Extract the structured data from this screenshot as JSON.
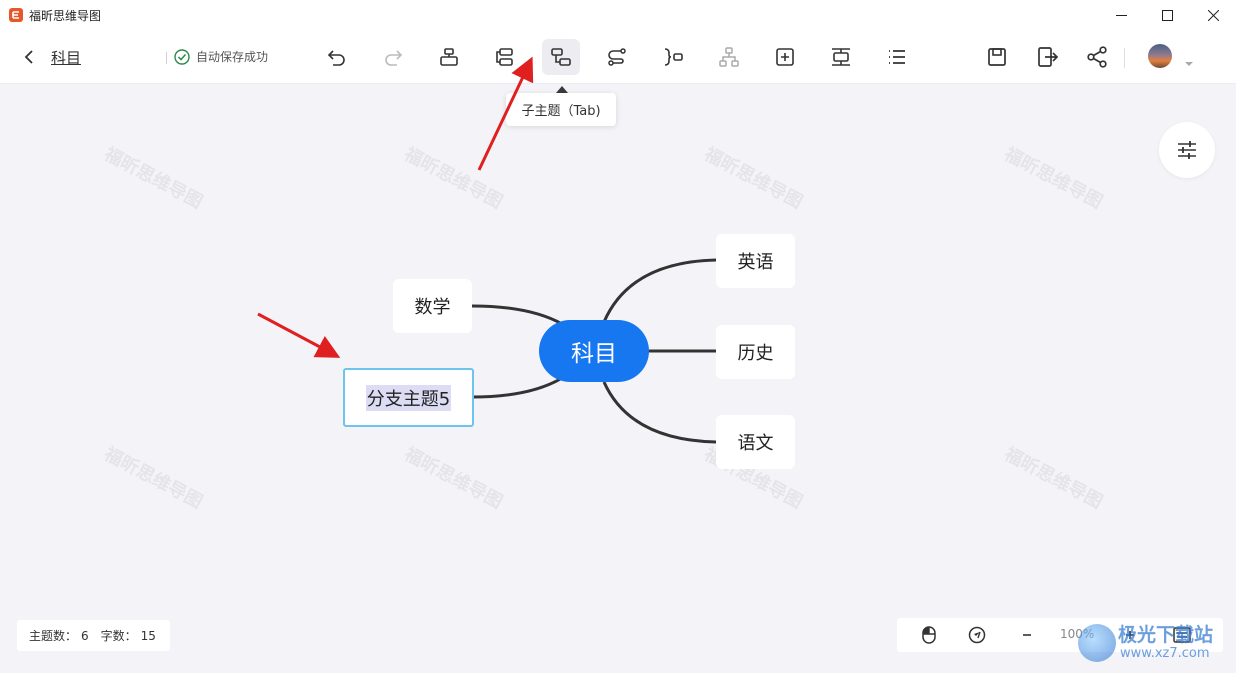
{
  "window": {
    "app_title": "福昕思维导图"
  },
  "toolbar": {
    "doc_title": "科目",
    "save_status": "自动保存成功"
  },
  "tooltip": {
    "text": "子主题（Tab)"
  },
  "watermark": {
    "text": "福昕思维导图"
  },
  "mindmap": {
    "root": "科目",
    "left_nodes": [
      "数学",
      "分支主题5"
    ],
    "right_nodes": [
      "英语",
      "历史",
      "语文"
    ],
    "selected_node": "分支主题5"
  },
  "status": {
    "topic_label": "主题数：",
    "topic_count": "6",
    "word_label": "字数：",
    "word_count": "15"
  },
  "zoom": {
    "level": "100%"
  },
  "site_watermark": {
    "name": "极光下载站",
    "url": "www.xz7.com"
  },
  "colors": {
    "root_blue": "#1677f0",
    "selected_border": "#6ec4ee",
    "annotation_red": "#e02020",
    "app_logo": "#e8572a"
  },
  "icons": {
    "toolbar": [
      "undo-icon",
      "redo-icon",
      "parent-topic-icon",
      "sibling-topic-icon",
      "child-topic-icon",
      "connection-icon",
      "summary-icon",
      "structure-icon",
      "insert-icon",
      "frame-icon",
      "outline-icon",
      "save-icon",
      "export-icon",
      "share-icon"
    ]
  }
}
